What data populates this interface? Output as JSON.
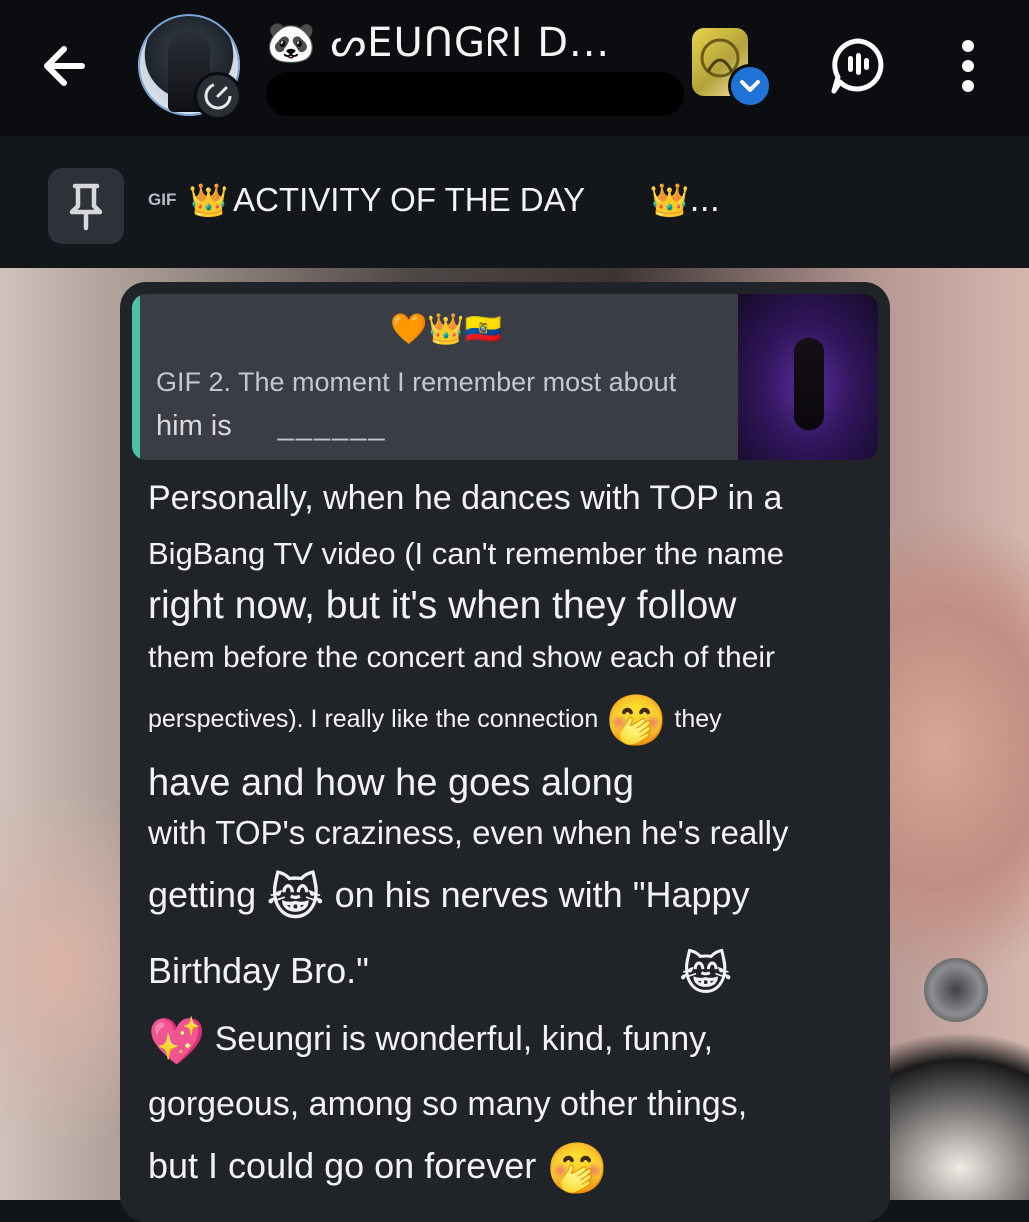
{
  "header": {
    "title": "🐼 ᔕEUᑎGᖇI D...",
    "icons": [
      "back-arrow-icon",
      "avatar",
      "community-icon",
      "verified-icon",
      "voice-chat-icon",
      "more-vertical-icon"
    ]
  },
  "pinned": {
    "tag": "GIF",
    "crown": "👑",
    "title": "ACTIVITY OF THE DAY",
    "trailing": "👑...",
    "icon": "pin-icon"
  },
  "reply": {
    "author_emojis": "🧡👑🇪🇨",
    "text_line1": "GIF 2. The moment I remember most about",
    "text_line2": "him is",
    "blank": "______",
    "accent_color": "#4bc1a8"
  },
  "message": {
    "line1": "Personally, when he dances with TOP in a",
    "line2": "BigBang TV video (I can't remember the name",
    "line3": "right now, but it's when they follow",
    "line4": "them before the concert and show each of their",
    "line5a": "perspectives). I really like the connection",
    "line5_emoji": "🤭",
    "line5b": "they",
    "line6": "have and how he goes along",
    "line7": "with TOP's craziness, even when he's really",
    "line8a": "getting",
    "line8_emoji": "😹",
    "line8b": "on his nerves with \"Happy",
    "line9": "Birthday Bro.\"",
    "line9_emoji": "😹",
    "line10_emoji": "💖",
    "line10": "Seungri is wonderful, kind, funny,",
    "line11": "gorgeous, among so many other things,",
    "line12": "but I could go on forever",
    "line12_emoji": "🤭"
  },
  "colors": {
    "topbar": "#0b0d10",
    "pinbar": "#13161b",
    "bubble": "#202328",
    "reply_box": "#3a3d43",
    "verified": "#1f73d6"
  }
}
